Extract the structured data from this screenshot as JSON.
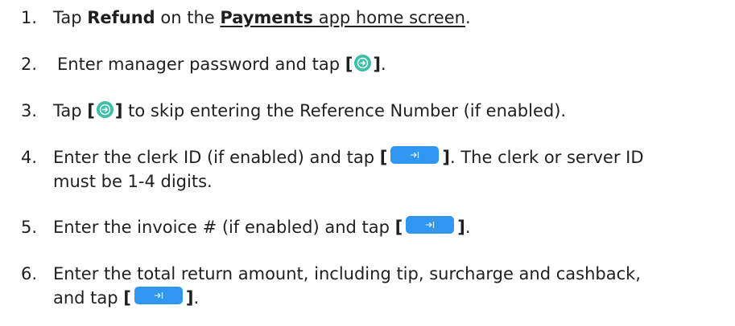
{
  "steps": [
    {
      "number": "1.",
      "parts": {
        "a": "Tap ",
        "b": "Refund",
        "c": " on the ",
        "d": "Payments",
        "e": " app home screen",
        "f": "."
      }
    },
    {
      "number": "2.",
      "parts": {
        "a": "Enter manager password and tap ",
        "open": "[",
        "close": "]",
        "end": "."
      },
      "icon": "arrow-right-circle-icon"
    },
    {
      "number": "3.",
      "parts": {
        "a": "Tap ",
        "open": "[",
        "close": "]",
        "b": " to skip entering the Reference Number (if enabled)."
      },
      "icon": "arrow-right-circle-icon"
    },
    {
      "number": "4.",
      "parts": {
        "a": "Enter the clerk ID (if enabled) and tap ",
        "open": "[",
        "close": "]",
        "b": ".  The clerk or server ID",
        "c": "must be 1-4 digits."
      },
      "icon": "tab-arrow-button-icon"
    },
    {
      "number": "5.",
      "parts": {
        "a": "Enter the invoice # (if enabled) and tap ",
        "open": "[",
        "close": "]",
        "end": "."
      },
      "icon": "tab-arrow-button-icon"
    },
    {
      "number": "6.",
      "parts": {
        "a": "Enter the total return amount, including tip, surcharge and cashback,",
        "b": "and tap ",
        "open": "[",
        "close": "]",
        "end": "."
      },
      "icon": "tab-arrow-button-icon"
    }
  ],
  "colors": {
    "circle_icon": "#3dbfa7",
    "pill_icon": "#2f97f2",
    "text": "#1f1f1f"
  }
}
